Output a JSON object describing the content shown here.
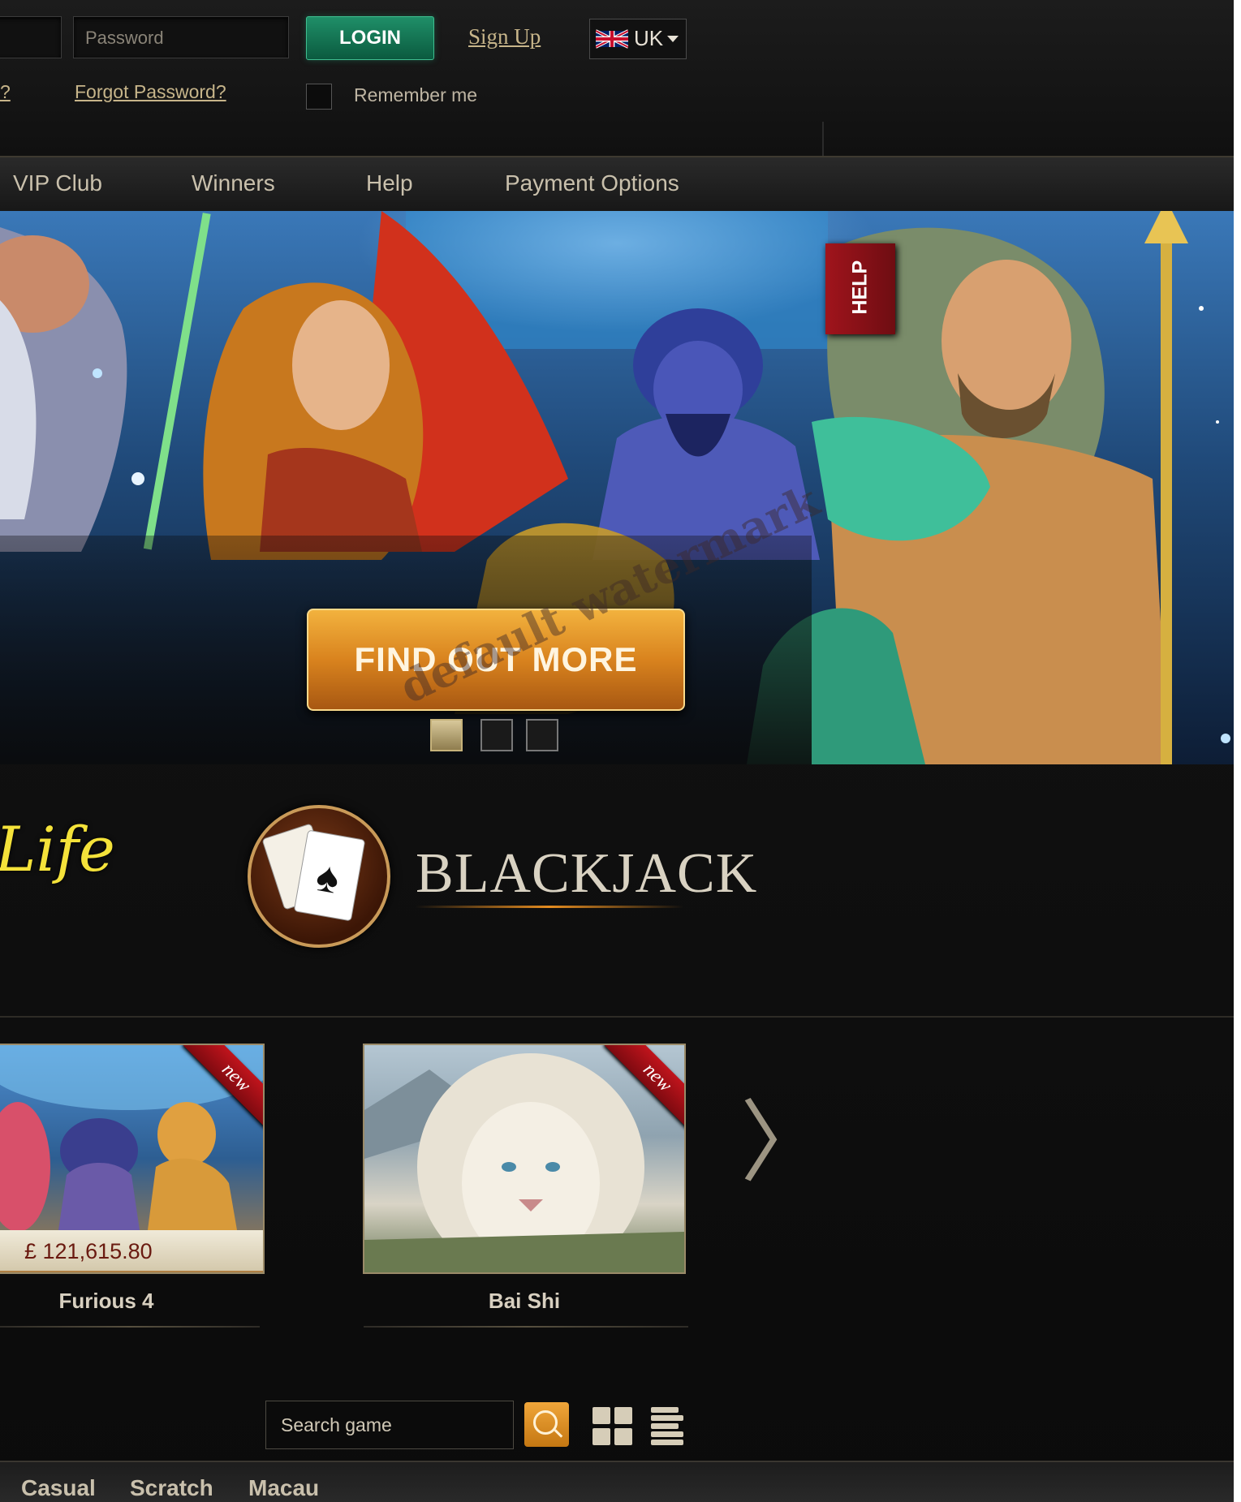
{
  "header": {
    "password_placeholder": "Password",
    "login_label": "LOGIN",
    "signup_label": "Sign Up",
    "language": "UK",
    "forgot_username_fragment": "?",
    "forgot_password_label": "Forgot Password?",
    "remember_label": "Remember me"
  },
  "nav": {
    "items": [
      "VIP Club",
      "Winners",
      "Help",
      "Payment Options"
    ]
  },
  "hero": {
    "cta_label": "FIND OUT MORE",
    "slide_count": 3,
    "active_slide": 1,
    "help_label": "HELP"
  },
  "brands": {
    "life_logo": "Life",
    "blackjack_logo": "BLACKJACK"
  },
  "games": [
    {
      "name": "Furious 4",
      "badge": "new",
      "jackpot": "£ 121,615.80"
    },
    {
      "name": "Bai Shi",
      "badge": "new"
    }
  ],
  "search": {
    "placeholder": "Search game"
  },
  "categories": [
    "Casual",
    "Scratch",
    "Macau"
  ],
  "watermark": "default watermark",
  "colors": {
    "login_green": "#1a8a62",
    "cta_orange": "#d9831e",
    "help_red": "#a0141c",
    "link_gold": "#c7b58a"
  }
}
